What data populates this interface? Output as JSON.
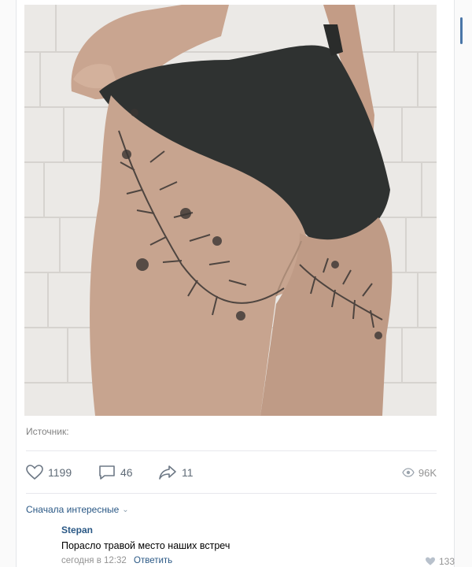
{
  "post": {
    "source_label": "Источник:",
    "likes": "1199",
    "comments": "46",
    "shares": "11",
    "views": "96K"
  },
  "comments_section": {
    "sort_label": "Сначала интересные"
  },
  "comment": {
    "author": "Stepan",
    "text": "Порасло травой место наших встреч",
    "time": "сегодня в 12:32",
    "reply_label": "Ответить",
    "likes": "133"
  },
  "colors": {
    "link": "#2a5885",
    "muted": "#828282",
    "accent": "#4a76a8"
  }
}
